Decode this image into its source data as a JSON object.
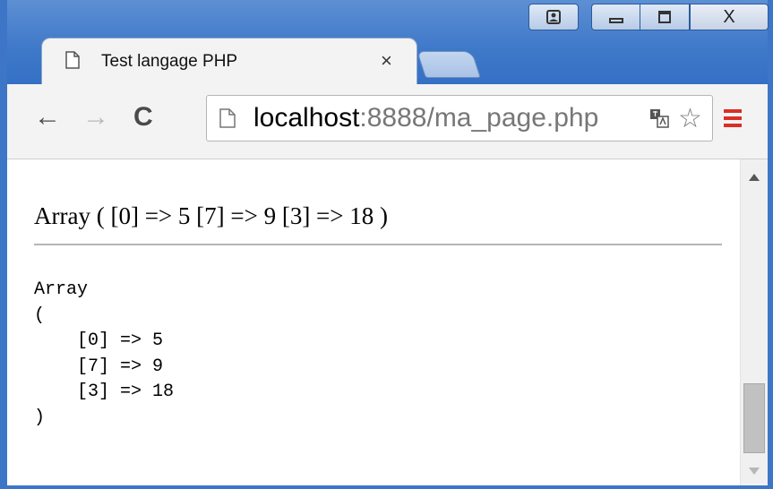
{
  "window": {
    "controls": {
      "user_icon": "user-icon",
      "minimize_icon": "minimize-icon",
      "maximize_icon": "maximize-icon",
      "close_label": "X"
    }
  },
  "tab": {
    "title": "Test langage PHP",
    "close": "×"
  },
  "toolbar": {
    "back": "←",
    "forward": "→",
    "reload": "C",
    "url_host": "localhost",
    "url_rest": ":8888/ma_page.php",
    "star": "☆"
  },
  "content": {
    "print_r_inline": "Array ( [0] => 5 [7] => 9 [3] => 18 )",
    "print_r_pre": "Array\n(\n    [0] => 5\n    [7] => 9\n    [3] => 18\n)"
  },
  "colors": {
    "frame": "#3d76c7",
    "menu_icon": "#d93025"
  }
}
